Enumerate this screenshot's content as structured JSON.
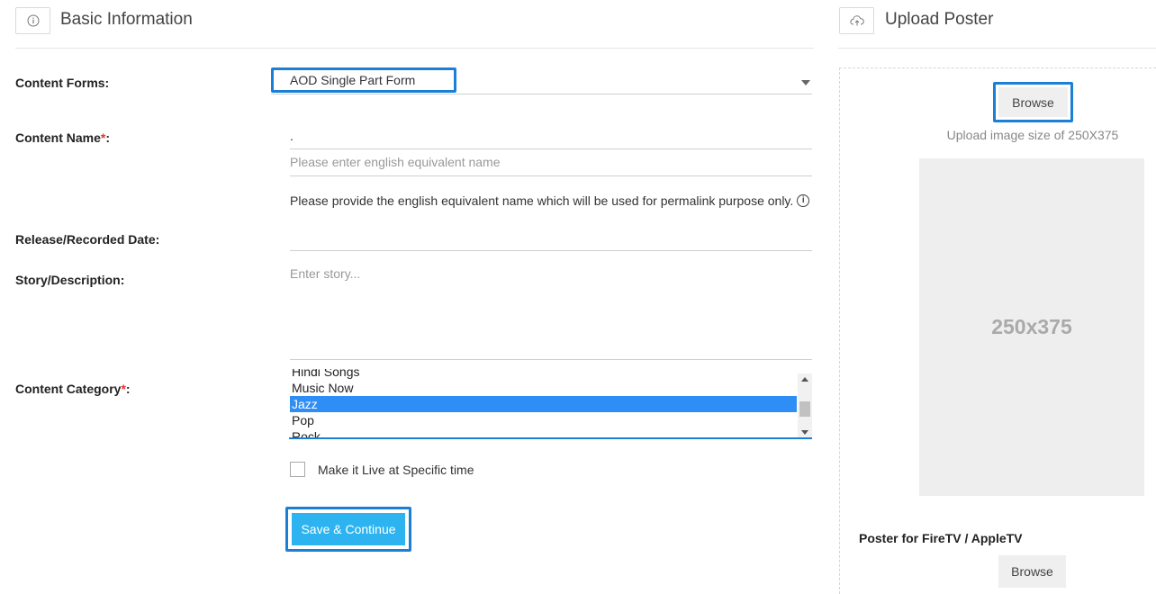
{
  "basic": {
    "title": "Basic Information",
    "icon": "info-circle-icon"
  },
  "form": {
    "content_forms": {
      "label": "Content Forms:",
      "value": "AOD Single Part Form"
    },
    "content_name": {
      "label": "Content Name",
      "required_mark": "*",
      "suffix": ":",
      "value": "."
    },
    "english_name": {
      "placeholder": "Please enter english equivalent name"
    },
    "hint": "Please provide the english equivalent name which will be used for permalink purpose only.",
    "hint_icon": "i",
    "release_date": {
      "label": "Release/Recorded Date:"
    },
    "story": {
      "label": "Story/Description:",
      "placeholder": "Enter story..."
    },
    "content_category": {
      "label": "Content Category",
      "required_mark": "*",
      "suffix": ":",
      "options": [
        "Hindi Songs",
        "Music Now",
        "Jazz",
        "Pop",
        "Rock"
      ],
      "selected": "Jazz"
    },
    "live_checkbox": {
      "label": "Make it Live at Specific time",
      "checked": false
    },
    "save_label": "Save & Continue"
  },
  "upload": {
    "title": "Upload Poster",
    "icon": "cloud-upload-icon",
    "browse_label": "Browse",
    "size_hint": "Upload image size of 250X375",
    "placeholder_text": "250x375",
    "firetv_label": "Poster for FireTV / AppleTV",
    "browse2_label": "Browse"
  },
  "colors": {
    "accent_outline": "#1b7fd6",
    "save_button": "#2db4f0",
    "selected_option": "#2f8ef5",
    "required": "#e3342f"
  }
}
